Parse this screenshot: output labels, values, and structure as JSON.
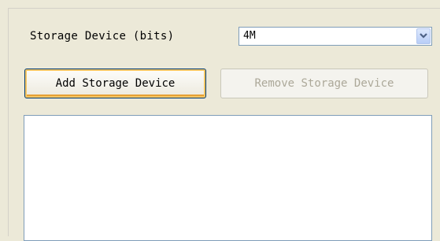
{
  "storage": {
    "label": "Storage Device (bits)",
    "selected_value": "4M"
  },
  "buttons": {
    "add_label": "Add Storage Device",
    "remove_label": "Remove Storage Device"
  },
  "device_list": {
    "items": []
  },
  "icons": {
    "dropdown": "chevron-down-icon"
  }
}
